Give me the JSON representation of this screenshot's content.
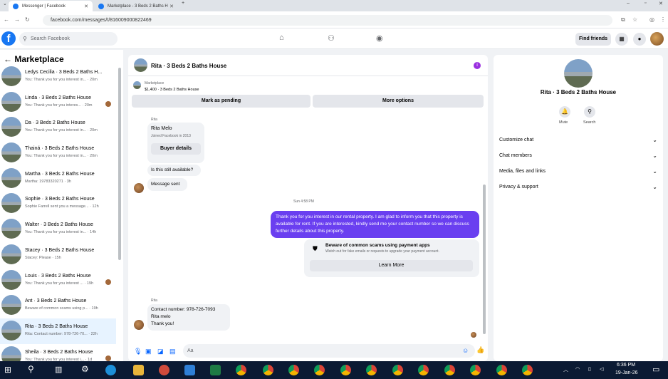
{
  "browser": {
    "tabs": [
      {
        "title": "Messenger | Facebook"
      },
      {
        "title": "Marketplace - 3 Beds 2 Baths H"
      }
    ],
    "url": "facebook.com/messages/t/816009000822469"
  },
  "header": {
    "search_placeholder": "Search Facebook",
    "find_friends": "Find friends"
  },
  "sidebar": {
    "title": "Marketplace",
    "items": [
      {
        "name": "Ledys Cecilia · 3 Beds 2 Baths H...",
        "preview": "You: Thank you for you interest in... · 20m",
        "avatar": false,
        "selected": false
      },
      {
        "name": "Linda · 3 Beds 2 Baths House",
        "preview": "You: Thank you for you interes... · 20m",
        "avatar": true,
        "selected": false
      },
      {
        "name": "Da · 3 Beds 2 Baths House",
        "preview": "You: Thank you for you interest in... · 20m",
        "avatar": false,
        "selected": false
      },
      {
        "name": "Thainá · 3 Beds 2 Baths House",
        "preview": "You: Thank you for you interest in... · 20m",
        "avatar": false,
        "selected": false
      },
      {
        "name": "Martha · 3 Beds 2 Baths House",
        "preview": "Martha: 19783320271 · 3h",
        "avatar": false,
        "selected": false
      },
      {
        "name": "Sophie · 3 Beds 2 Baths House",
        "preview": "Sophie Farrell sent you a message... · 12h",
        "avatar": false,
        "selected": false
      },
      {
        "name": "Walter · 3 Beds 2 Baths House",
        "preview": "You: Thank you for you interest in... · 14h",
        "avatar": false,
        "selected": false
      },
      {
        "name": "Stacey · 3 Beds 2 Baths House",
        "preview": "Stacey: Please · 15h",
        "avatar": false,
        "selected": false
      },
      {
        "name": "Louis · 3 Beds 2 Baths House",
        "preview": "You: Thank you for you interest ... · 19h",
        "avatar": true,
        "selected": false
      },
      {
        "name": "Ant · 3 Beds 2 Baths House",
        "preview": "Beware of common scams using p... · 19h",
        "avatar": false,
        "selected": false
      },
      {
        "name": "Rita · 3 Beds 2 Baths House",
        "preview": "Rita: Contact number: 978-726-70... · 22h",
        "avatar": false,
        "selected": true
      },
      {
        "name": "Sheila · 3 Beds 2 Baths House",
        "preview": "You: Thank you for you interest i... · 1d",
        "avatar": true,
        "selected": false
      }
    ]
  },
  "chat": {
    "title": "Rita · 3 Beds 2 Baths House",
    "marketplace_label": "Marketplace",
    "listing": "$1,400 · 3 Beds 2 Baths House",
    "mark_pending": "Mark as pending",
    "more_options": "More options",
    "sender_label": "Rita",
    "profile_name": "Rita Melo",
    "joined": "Joined Facebook in 2013",
    "buyer_details": "Buyer details",
    "still_available": "Is this still available?",
    "message_sent": "Message sent",
    "timestamp": "Sun 4:58 PM",
    "outgoing": "Thank you for you interest in our rental property. I am glad to inform you that this property is available for rent. If you are interested, kindly send me your contact number so we can discuss further details about this property.",
    "scam_title": "Beware of common scams using payment apps",
    "scam_body": "Watch out for fake emails or requests to upgrade your payment account.",
    "learn_more": "Learn More",
    "sender_label2": "Rita",
    "reply_line1": "Contact number: 978-726-7093",
    "reply_line2": "Rita melo",
    "reply_line3": "Thank you!",
    "composer_placeholder": "Aa"
  },
  "right_panel": {
    "title": "Rita · 3 Beds 2 Baths House",
    "mute": "Mute",
    "search": "Search",
    "rows": [
      "Customize chat",
      "Chat members",
      "Media, files and links",
      "Privacy & support"
    ]
  },
  "taskbar": {
    "time": "6:36 PM",
    "date": "19-Jan-26"
  }
}
